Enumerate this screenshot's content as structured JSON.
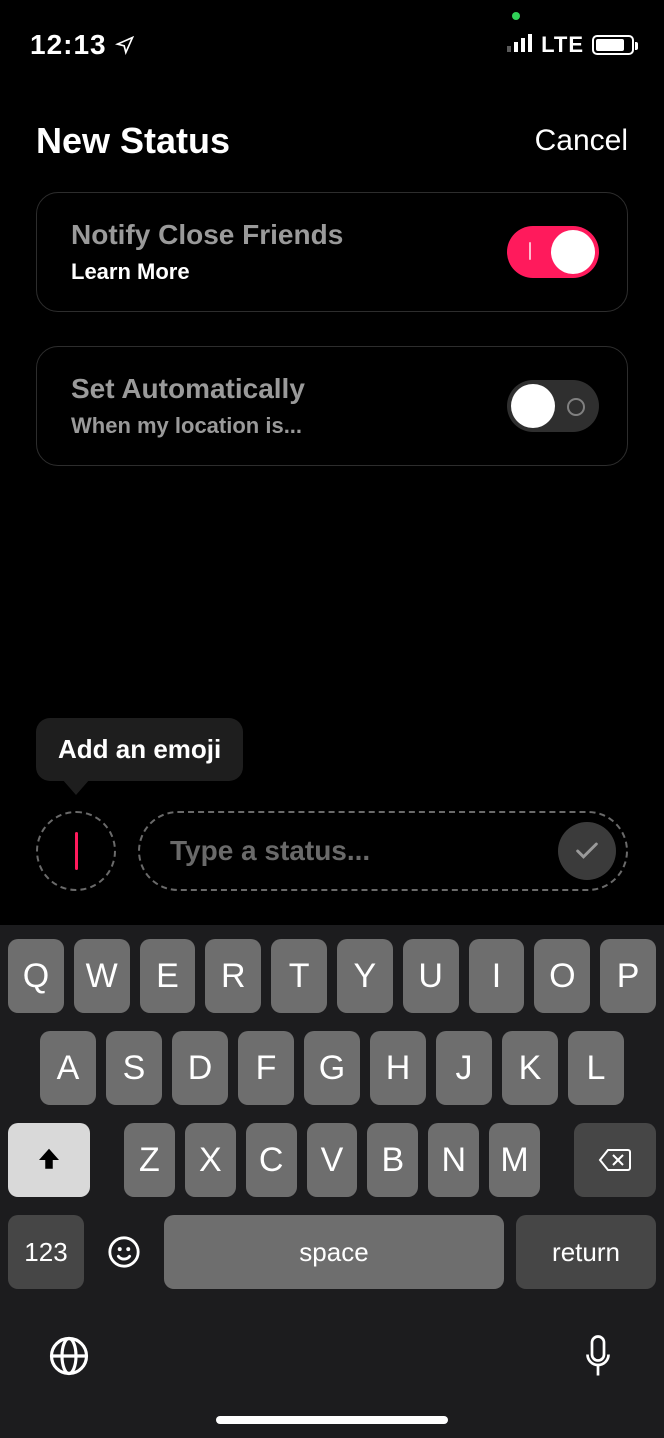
{
  "status_bar": {
    "time": "12:13",
    "network": "LTE"
  },
  "header": {
    "title": "New Status",
    "cancel": "Cancel"
  },
  "cards": {
    "notify": {
      "title": "Notify Close Friends",
      "sub": "Learn More",
      "on": true
    },
    "auto": {
      "title": "Set Automatically",
      "sub": "When my location is...",
      "on": false
    }
  },
  "compose": {
    "tooltip": "Add an emoji",
    "placeholder": "Type a status..."
  },
  "keyboard": {
    "row1": [
      "Q",
      "W",
      "E",
      "R",
      "T",
      "Y",
      "U",
      "I",
      "O",
      "P"
    ],
    "row2": [
      "A",
      "S",
      "D",
      "F",
      "G",
      "H",
      "J",
      "K",
      "L"
    ],
    "row3": [
      "Z",
      "X",
      "C",
      "V",
      "B",
      "N",
      "M"
    ],
    "numKey": "123",
    "space": "space",
    "returnKey": "return"
  }
}
